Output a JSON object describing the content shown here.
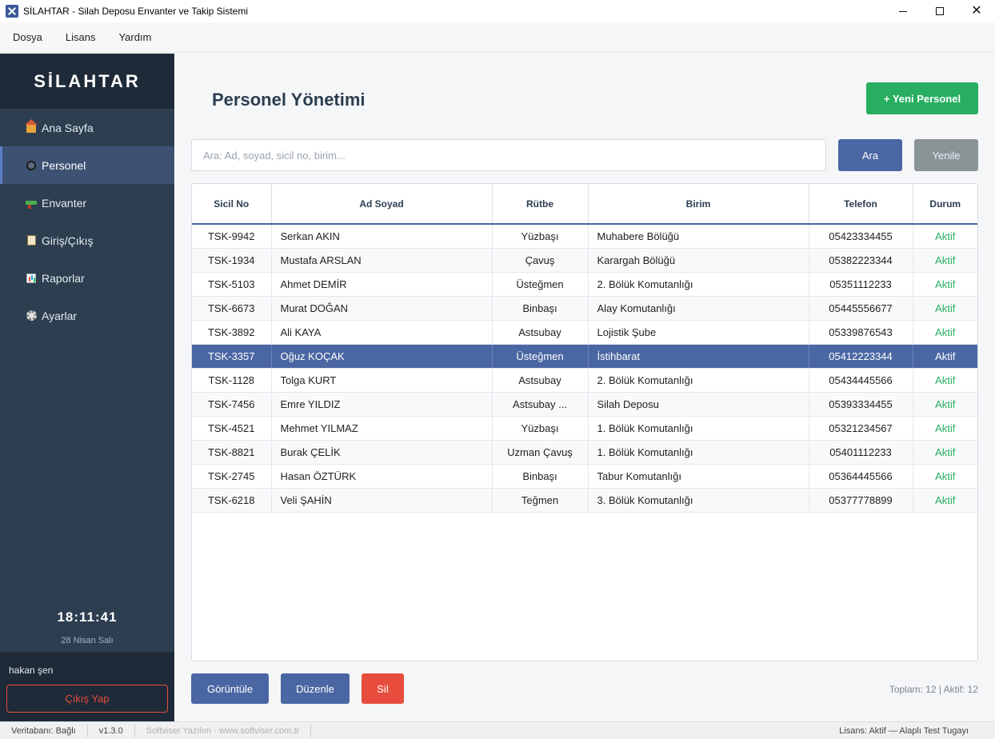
{
  "window": {
    "title": "SİLAHTAR - Silah Deposu Envanter ve Takip Sistemi",
    "minimize": "",
    "maximize": "",
    "close": "✕"
  },
  "menu": [
    "Dosya",
    "Lisans",
    "Yardım"
  ],
  "sidebar": {
    "logo": "SİLAHTAR",
    "items": [
      {
        "label": "Ana Sayfa",
        "icon": "home-icon"
      },
      {
        "label": "Personel",
        "icon": "person-icon",
        "active": true
      },
      {
        "label": "Envanter",
        "icon": "rifle-icon"
      },
      {
        "label": "Giriş/Çıkış",
        "icon": "clipboard-icon"
      },
      {
        "label": "Raporlar",
        "icon": "chart-icon"
      },
      {
        "label": "Ayarlar",
        "icon": "gear-icon"
      }
    ],
    "clock": "18:11:41",
    "date": "28 Nisan Salı",
    "user": "hakan şen",
    "logout_label": "Çıkış Yap"
  },
  "main": {
    "title": "Personel Yönetimi",
    "new_button": "+ Yeni Personel",
    "search": {
      "placeholder": "Ara: Ad, soyad, sicil no, birim...",
      "value": ""
    },
    "search_button": "Ara",
    "refresh_button": "Yenile",
    "table": {
      "columns": [
        "Sicil No",
        "Ad Soyad",
        "Rütbe",
        "Birim",
        "Telefon",
        "Durum"
      ],
      "rows": [
        [
          "TSK-9942",
          "Serkan AKIN",
          "Yüzbaşı",
          "Muhabere Bölüğü",
          "05423334455",
          "Aktif"
        ],
        [
          "TSK-1934",
          "Mustafa ARSLAN",
          "Çavuş",
          "Karargah Bölüğü",
          "05382223344",
          "Aktif"
        ],
        [
          "TSK-5103",
          "Ahmet DEMİR",
          "Üsteğmen",
          "2. Bölük Komutanlığı",
          "05351112233",
          "Aktif"
        ],
        [
          "TSK-6673",
          "Murat DOĞAN",
          "Binbaşı",
          "Alay Komutanlığı",
          "05445556677",
          "Aktif"
        ],
        [
          "TSK-3892",
          "Ali KAYA",
          "Astsubay",
          "Lojistik Şube",
          "05339876543",
          "Aktif"
        ],
        [
          "TSK-3357",
          "Oğuz KOÇAK",
          "Üsteğmen",
          "İstihbarat",
          "05412223344",
          "Aktif"
        ],
        [
          "TSK-1128",
          "Tolga KURT",
          "Astsubay",
          "2. Bölük Komutanlığı",
          "05434445566",
          "Aktif"
        ],
        [
          "TSK-7456",
          "Emre YILDIZ",
          "Astsubay ...",
          "Silah Deposu",
          "05393334455",
          "Aktif"
        ],
        [
          "TSK-4521",
          "Mehmet YILMAZ",
          "Yüzbaşı",
          "1. Bölük Komutanlığı",
          "05321234567",
          "Aktif"
        ],
        [
          "TSK-8821",
          "Burak ÇELİK",
          "Uzman Çavuş",
          "1. Bölük Komutanlığı",
          "05401112233",
          "Aktif"
        ],
        [
          "TSK-2745",
          "Hasan ÖZTÜRK",
          "Binbaşı",
          "Tabur Komutanlığı",
          "05364445566",
          "Aktif"
        ],
        [
          "TSK-6218",
          "Veli ŞAHİN",
          "Teğmen",
          "3. Bölük Komutanlığı",
          "05377778899",
          "Aktif"
        ]
      ],
      "selected_row": 5
    },
    "view_button": "Görüntüle",
    "edit_button": "Düzenle",
    "delete_button": "Sil",
    "totals": "Toplam: 12 | Aktif: 12"
  },
  "statusbar": {
    "db": "Veritabanı: Bağlı",
    "version": "v1.3.0",
    "company": "Softviser Yazılım · www.softviser.com.tr",
    "license": "Lisans: Aktif — Alaplı Test Tugayı"
  },
  "colors": {
    "sidebar_bg": "#2c3e50",
    "accent_blue": "#4a67a3",
    "success_green": "#27ae60",
    "danger_red": "#e74c3c"
  }
}
